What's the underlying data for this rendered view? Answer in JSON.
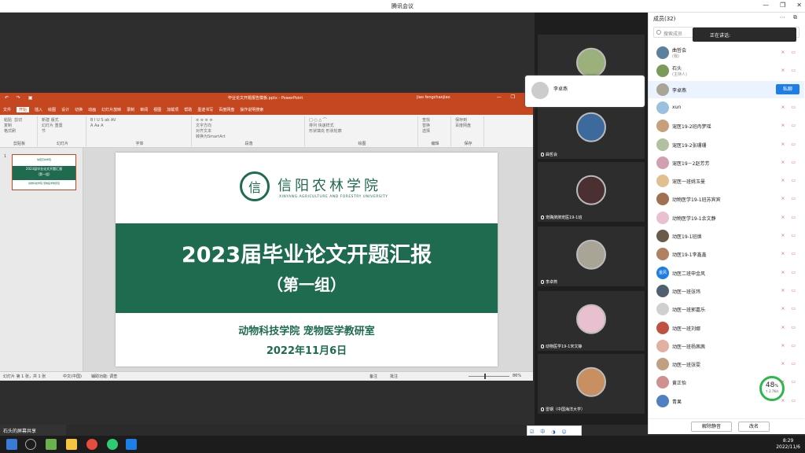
{
  "window": {
    "title": "腾讯会议",
    "controls": [
      "—",
      "❐",
      "✕"
    ]
  },
  "ppt": {
    "filename": "毕业论文开题报告模板.pptx - PowerPoint",
    "user": "jiao fengchaojiao",
    "quick_access": "↶ ↷ ▣",
    "menus": [
      "文件",
      "开始",
      "插入",
      "绘图",
      "设计",
      "切换",
      "动画",
      "幻灯片放映",
      "录制",
      "审阅",
      "视图",
      "加载项",
      "帮助",
      "墨迹书写",
      "百度网盘",
      "操作说明搜索"
    ],
    "active_menu": "开始",
    "ribbon_groups": [
      {
        "label": "剪贴板",
        "body": "粘贴  剪切\n复制\n格式刷"
      },
      {
        "label": "幻灯片",
        "body": "新建 版式\n幻灯片 重置\n节"
      },
      {
        "label": "字体",
        "body": "B I U S ab AV\nA Aa A"
      },
      {
        "label": "段落",
        "body": "≡ ≡ ≡ ≡\n文字方向\n对齐文本\n转换为SmartArt"
      },
      {
        "label": "绘图",
        "body": "□ ○ △ ⌒\n排列 快速样式\n形状填充 形状轮廓"
      },
      {
        "label": "编辑",
        "body": "查找\n替换\n选择"
      },
      {
        "label": "保存",
        "body": "保存到\n百度网盘"
      }
    ],
    "thumb_number": "1",
    "thumb": {
      "school": "信阳农林学院",
      "title": "2023届毕业论文开题汇报",
      "sub": "（第一组）",
      "dept": "动物科技学院 宠物医学教研室"
    },
    "slide": {
      "logo_text": "信",
      "university": "信阳农林学院",
      "university_en": "XINYANG AGRICULTURE AND FORESTRY UNIVERSITY",
      "title": "2023届毕业论文开题汇报",
      "subtitle": "（第一组）",
      "department": "动物科技学院  宠物医学教研室",
      "date": "2022年11月6日"
    },
    "status": {
      "slide_info": "幻灯片 第 1 张，共 1 张",
      "language": "中文(中国)",
      "accessibility": "辅助功能: 调查",
      "notes": "备注",
      "comments": "批注",
      "zoom": "86%"
    }
  },
  "gallery": {
    "popover_name": "李卓燕",
    "tiles": [
      {
        "name": "",
        "color": "#9bb07a"
      },
      {
        "name": "曲哲会",
        "color": "#3d6a9c"
      },
      {
        "name": "宠确漪漪宠医19-1班",
        "color": "#4a3030"
      },
      {
        "name": "李卓燕",
        "color": "#a9a596"
      },
      {
        "name": "动物医学19-1宋文静",
        "color": "#e9c0cf"
      },
      {
        "name": "雷钢（中国海洋大学）",
        "color": "#c89060"
      }
    ]
  },
  "panel": {
    "header": "成员(32)",
    "header_icons": "⋯ ⧉",
    "search_placeholder": "搜索成员",
    "speaking_label": "正在讲话:",
    "members": [
      {
        "name": "曲哲会",
        "role": "(我)",
        "color": "#5b7f9e"
      },
      {
        "name": "石头",
        "role": "(主持人)",
        "color": "#7a9a5a"
      },
      {
        "name": "李卓燕",
        "role": "",
        "color": "#a9a596",
        "selected": true
      },
      {
        "name": "xun",
        "role": "",
        "color": "#9ac0e0"
      },
      {
        "name": "宠医19-2班冉梦瑶",
        "role": "",
        "color": "#c7a07a"
      },
      {
        "name": "宠医19-2张珊珊",
        "role": "",
        "color": "#b0c0a0"
      },
      {
        "name": "宠医19－2赵芳芳",
        "role": "",
        "color": "#d0a0b0"
      },
      {
        "name": "宠医一班姚玉曼",
        "role": "",
        "color": "#e0c090"
      },
      {
        "name": "动物医学19-1班苏宾宾",
        "role": "",
        "color": "#a07050"
      },
      {
        "name": "动物医学19-1余文静",
        "role": "",
        "color": "#e9c0cf"
      },
      {
        "name": "动医19-1班焕",
        "role": "",
        "color": "#6a5a4a"
      },
      {
        "name": "动医19-1李鑫鑫",
        "role": "",
        "color": "#b08060"
      },
      {
        "name": "动医二班申金风",
        "role": "",
        "color": "#1f7ee6",
        "initial": "金风"
      },
      {
        "name": "动医一班张玮",
        "role": "",
        "color": "#506070"
      },
      {
        "name": "动医一班郭嘉乐",
        "role": "",
        "color": "#d0d0d0"
      },
      {
        "name": "动医一班刘娜",
        "role": "",
        "color": "#c05040"
      },
      {
        "name": "动医一班杨茜茜",
        "role": "",
        "color": "#e0b0a0"
      },
      {
        "name": "动医一班张雯",
        "role": "",
        "color": "#c0a080"
      },
      {
        "name": "黄正怡",
        "role": "",
        "color": "#d09090"
      },
      {
        "name": "青果",
        "role": "",
        "color": "#5080c0"
      }
    ],
    "private_chat_label": "私聊",
    "unmute_all": "解除静音",
    "rename": "改名"
  },
  "network": {
    "percent": "48",
    "unit": "%",
    "speed": "↑ 2.7K/s"
  },
  "sharebar": {
    "label": "石头的屏幕共享"
  },
  "ime": {
    "text": "☑ 中 ◑ ☺ ⚙"
  },
  "taskbar": {
    "time": "8:29",
    "date": "2022/11/6"
  }
}
